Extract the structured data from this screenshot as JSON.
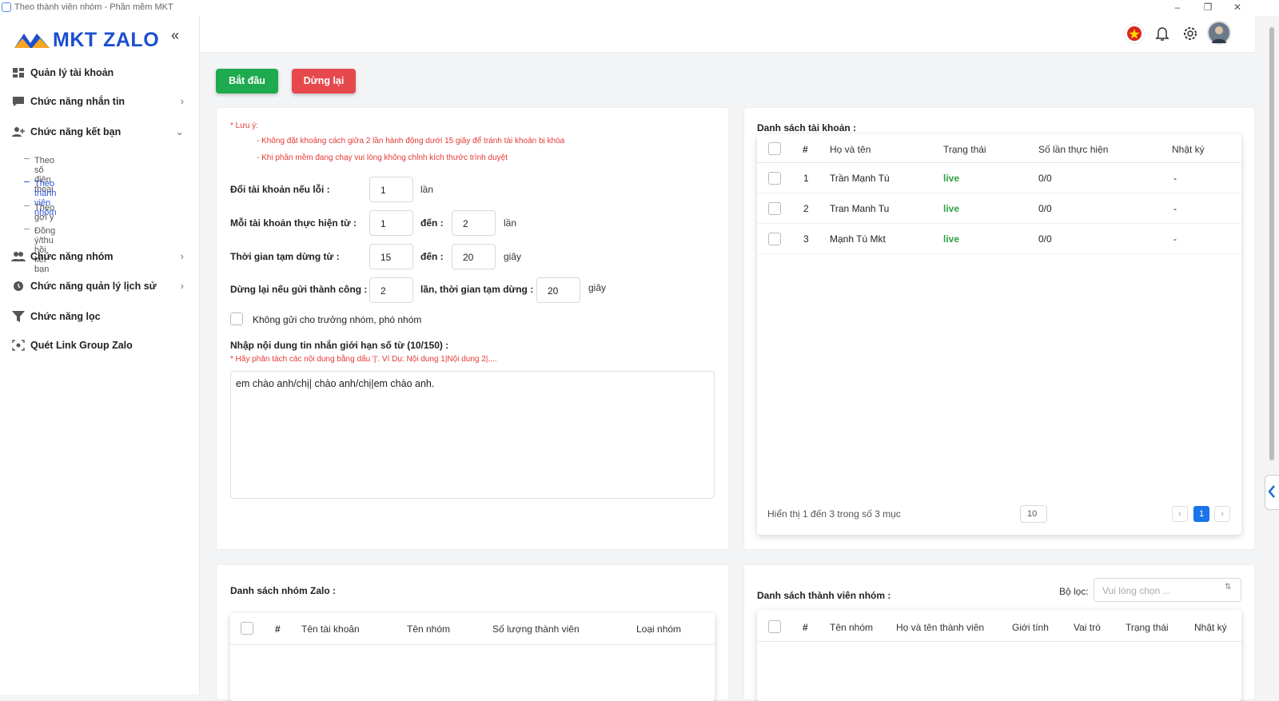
{
  "window": {
    "title": "Theo thành viên nhóm - Phần mềm MKT",
    "controls": [
      "–",
      "❐",
      "✕"
    ]
  },
  "brand": {
    "name": "MKT ZALO",
    "primary": "#1c4fd0",
    "start_color": "#1eaa4e",
    "stop_color": "#e5484d"
  },
  "sidebar": {
    "collapse_icon": "«",
    "items": [
      {
        "label": "Quản lý tài khoản",
        "icon": "grid-icon"
      },
      {
        "label": "Chức năng nhắn tin",
        "icon": "chat-icon",
        "arrow": "›"
      },
      {
        "label": "Chức năng kết bạn",
        "icon": "add-friend-icon",
        "arrow": "⌄"
      },
      {
        "label": "Chức năng nhóm",
        "icon": "group-icon",
        "arrow": "›"
      },
      {
        "label": "Chức năng quản lý lịch sử",
        "icon": "history-icon",
        "arrow": "›"
      },
      {
        "label": "Chức năng lọc",
        "icon": "filter-icon"
      },
      {
        "label": "Quét Link Group Zalo",
        "icon": "scan-icon"
      }
    ],
    "subitems": [
      {
        "label": "Theo số điện thoại"
      },
      {
        "label": "Theo thành viên nhóm"
      },
      {
        "label": "Theo gợi ý"
      },
      {
        "label": "Đồng ý/thu hồi kết bạn"
      }
    ]
  },
  "toolbar": {
    "start_label": "Bắt đầu",
    "stop_label": "Dừng lại"
  },
  "settings": {
    "note_title": "* Lưu ý:",
    "note_1": "- Không đặt khoảng cách giữa 2 lần hành động dưới 15 giây để tránh tài khoản bị khóa",
    "note_2": "- Khi phần mềm đang chạy vui lòng không chỉnh kích thước trình duyệt",
    "switch_label": "Đổi tài khoản nếu lỗi :",
    "switch_value": "1",
    "switch_unit": "lần",
    "per_account_label": "Mỗi tài khoản thực hiện từ :",
    "per_account_from": "1",
    "to_label": "đến :",
    "per_account_to": "2",
    "per_account_unit": "lần",
    "pause_label": "Thời gian tạm dừng từ :",
    "pause_from": "15",
    "pause_to": "20",
    "pause_unit": "giây",
    "stop_label": "Dừng lại nếu gửi thành công :",
    "stop_value": "2",
    "stop_mid": "lần, thời gian tạm dừng :",
    "stop_pause": "20",
    "stop_unit": "giây",
    "skip_admin_label": "Không gửi cho trưởng nhóm, phó nhóm",
    "message_label": "Nhập nội dung tin nhắn giới hạn số từ (10/150) :",
    "message_hint": "* Hãy phân tách các nội dung bằng dấu '|'. Ví Dụ: Nội dung 1|Nội dung 2|....",
    "message_value": "em chào anh/chị| chào anh/chị|em chào anh."
  },
  "accounts": {
    "title": "Danh sách tài khoản :",
    "headers": [
      "#",
      "Họ và tên",
      "Trạng thái",
      "Số lần thực hiện",
      "Nhật ký"
    ],
    "rows": [
      {
        "no": "1",
        "name": "Trần Mạnh Tú",
        "status": "live",
        "count": "0/0",
        "log": "-"
      },
      {
        "no": "2",
        "name": "Tran Manh Tu",
        "status": "live",
        "count": "0/0",
        "log": "-"
      },
      {
        "no": "3",
        "name": "Mạnh Tú Mkt",
        "status": "live",
        "count": "0/0",
        "log": "-"
      }
    ],
    "showing": "Hiển thị 1 đến 3 trong số 3 mục",
    "page_size": "10",
    "page": "1",
    "prev": "‹",
    "next": "›"
  },
  "groups": {
    "title": "Danh sách nhóm Zalo :",
    "headers": [
      "#",
      "Tên tài khoản",
      "Tên nhóm",
      "Số lượng thành viên",
      "Loại nhóm"
    ]
  },
  "members": {
    "title": "Danh sách thành viên nhóm :",
    "filter_label": "Bộ lọc:",
    "filter_placeholder": "Vui lòng chọn ...",
    "headers": [
      "#",
      "Tên nhóm",
      "Họ và tên thành viên",
      "Giới tính",
      "Vai trò",
      "Trạng thái",
      "Nhật ký"
    ]
  }
}
